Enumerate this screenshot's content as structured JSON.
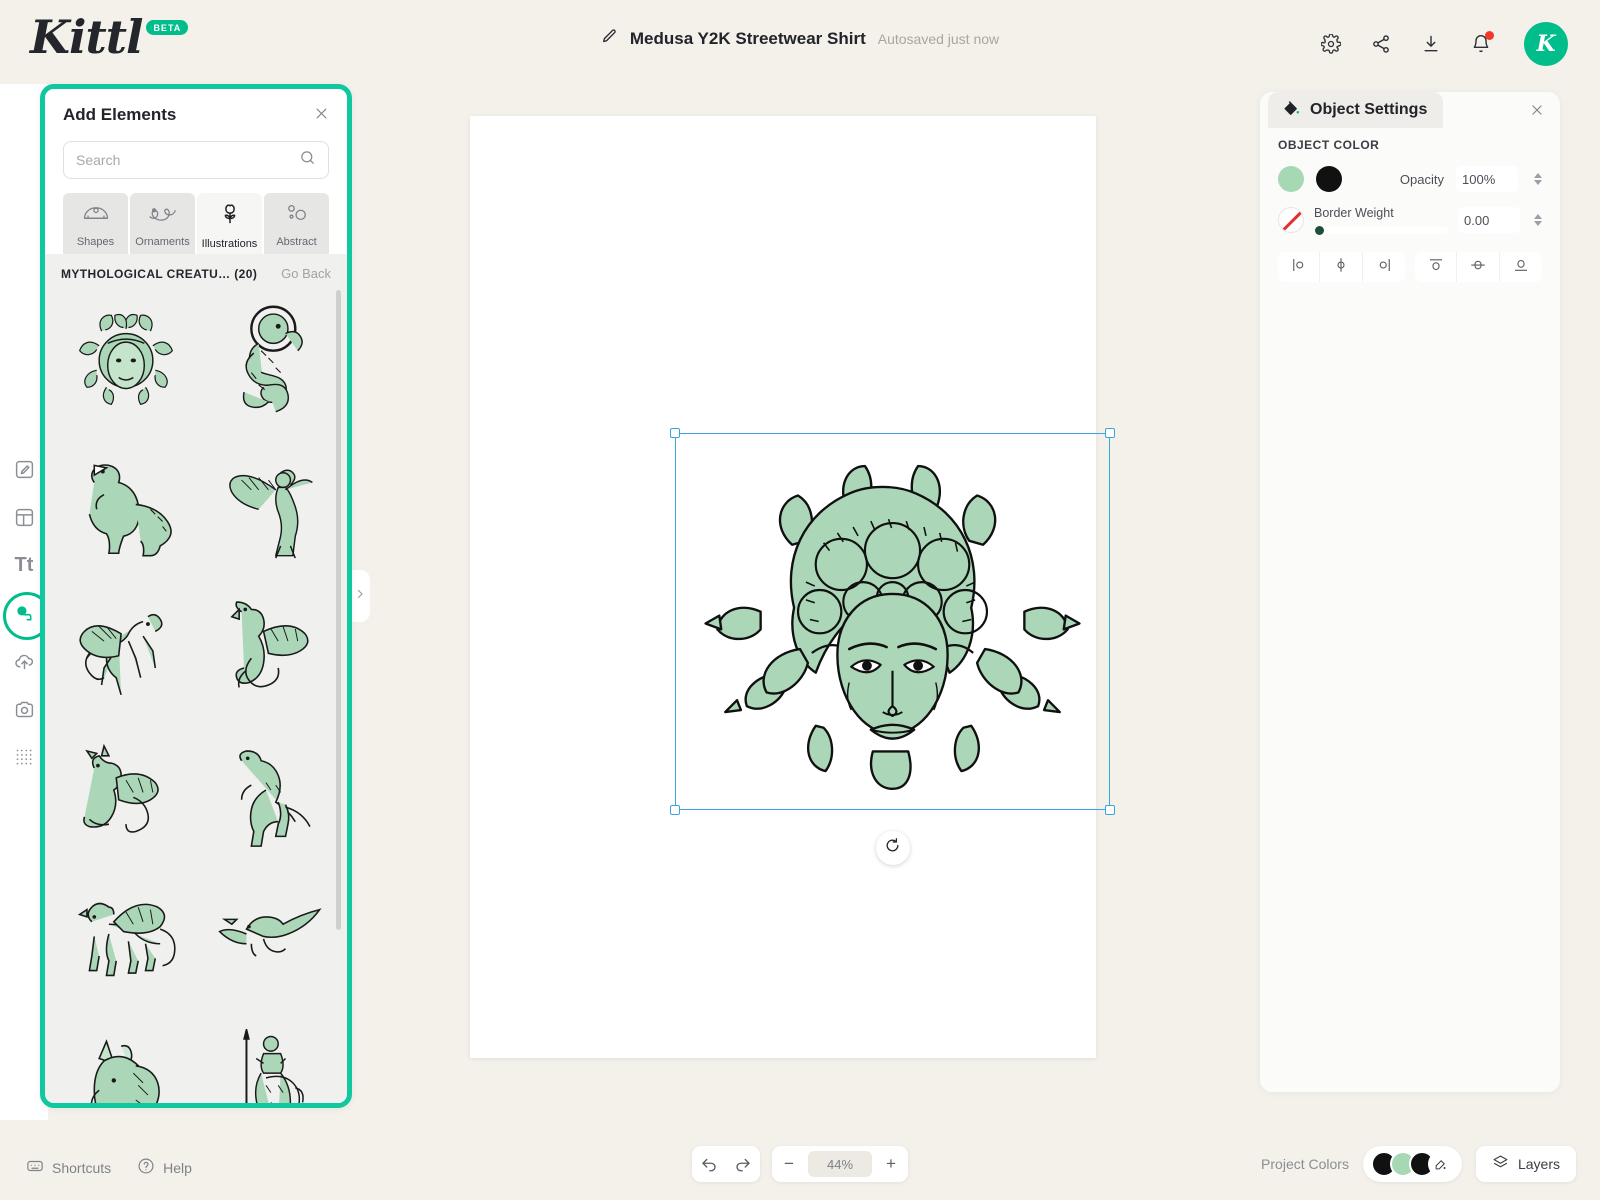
{
  "app": {
    "brand": "Kittl",
    "brand_badge": "BETA",
    "avatar_initial": "K",
    "accent_green": "#00bd8b",
    "panel_highlight": "#10c8a0",
    "art_green": "#abd7b8",
    "selection_blue": "#3ba5e0"
  },
  "header": {
    "document_title": "Medusa Y2K Streetwear Shirt",
    "save_status": "Autosaved just now",
    "pencil_icon": "pencil-icon",
    "actions": [
      {
        "name": "settings-button",
        "icon": "gear-icon"
      },
      {
        "name": "share-button",
        "icon": "share-icon"
      },
      {
        "name": "download-button",
        "icon": "download-icon"
      },
      {
        "name": "notifications-button",
        "icon": "bell-icon",
        "badge": true
      }
    ]
  },
  "rail": {
    "items": [
      {
        "name": "sidebar-item-design",
        "icon": "pencil-square-icon",
        "active": false
      },
      {
        "name": "sidebar-item-templates",
        "icon": "layout-icon",
        "active": false
      },
      {
        "name": "sidebar-item-text",
        "icon": "text-icon",
        "label": "Tt",
        "active": false
      },
      {
        "name": "sidebar-item-elements",
        "icon": "elements-icon",
        "active": true
      },
      {
        "name": "sidebar-item-uploads",
        "icon": "upload-cloud-icon",
        "active": false
      },
      {
        "name": "sidebar-item-photos",
        "icon": "camera-icon",
        "active": false
      },
      {
        "name": "sidebar-item-patterns",
        "icon": "grid-dots-icon",
        "active": false
      }
    ]
  },
  "panel": {
    "title": "Add Elements",
    "close_icon": "close-icon",
    "search": {
      "placeholder": "Search",
      "value": "",
      "icon": "search-icon"
    },
    "tabs": [
      {
        "label": "Shapes",
        "icon": "shapes-icon",
        "active": false
      },
      {
        "label": "Ornaments",
        "icon": "ornaments-icon",
        "active": false
      },
      {
        "label": "Illustrations",
        "icon": "illustrations-icon",
        "active": true
      },
      {
        "label": "Abstract",
        "icon": "abstract-icon",
        "active": false
      }
    ],
    "results": {
      "category_label": "MYTHOLOGICAL CREATU… (20)",
      "go_back_label": "Go Back",
      "items": [
        {
          "name": "thumb-medusa",
          "art": "medusa"
        },
        {
          "name": "thumb-chinese-dragon",
          "art": "chinese-dragon"
        },
        {
          "name": "thumb-t-rex",
          "art": "t-rex"
        },
        {
          "name": "thumb-harpy",
          "art": "harpy"
        },
        {
          "name": "thumb-pegasus",
          "art": "pegasus"
        },
        {
          "name": "thumb-wyvern",
          "art": "wyvern"
        },
        {
          "name": "thumb-dragon",
          "art": "dragon"
        },
        {
          "name": "thumb-raptor",
          "art": "raptor"
        },
        {
          "name": "thumb-griffin",
          "art": "griffin"
        },
        {
          "name": "thumb-pterodactyl",
          "art": "pterodactyl"
        },
        {
          "name": "thumb-unicorn",
          "art": "unicorn"
        },
        {
          "name": "thumb-centaur",
          "art": "centaur"
        }
      ]
    },
    "collapse_icon": "chevron-right-icon"
  },
  "canvas": {
    "artwork_name": "medusa-illustration",
    "rotate_icon": "rotate-icon",
    "selected": true
  },
  "object_settings": {
    "title": "Object Settings",
    "panel_icon": "paint-bucket-icon",
    "close_icon": "close-icon",
    "color_section_label": "OBJECT COLOR",
    "swatches": [
      {
        "name": "object-color-swatch-green",
        "color": "#a6d8b4"
      },
      {
        "name": "object-color-swatch-black",
        "color": "#111111"
      }
    ],
    "opacity_label": "Opacity",
    "opacity_value": "100%",
    "border_color_name": "no-border-color",
    "border_weight_label": "Border Weight",
    "border_weight_value": "0.00",
    "align_buttons": [
      {
        "name": "align-left-button",
        "icon": "align-left-icon"
      },
      {
        "name": "align-center-horizontal-button",
        "icon": "align-center-h-icon"
      },
      {
        "name": "align-right-button",
        "icon": "align-right-icon"
      },
      {
        "name": "align-top-button",
        "icon": "align-top-icon"
      },
      {
        "name": "align-middle-vertical-button",
        "icon": "align-middle-v-icon"
      },
      {
        "name": "align-bottom-button",
        "icon": "align-bottom-icon"
      }
    ]
  },
  "bottom": {
    "shortcuts_label": "Shortcuts",
    "shortcuts_icon": "keyboard-icon",
    "help_label": "Help",
    "help_icon": "question-circle-icon",
    "undo_icon": "undo-icon",
    "redo_icon": "redo-icon",
    "zoom_out_label": "−",
    "zoom_in_label": "+",
    "zoom_value": "44%",
    "project_colors_label": "Project Colors",
    "project_colors": [
      "#111111",
      "#a6d8b4",
      "#111111"
    ],
    "color_picker_icon": "color-picker-icon",
    "layers_label": "Layers",
    "layers_icon": "layers-icon"
  }
}
